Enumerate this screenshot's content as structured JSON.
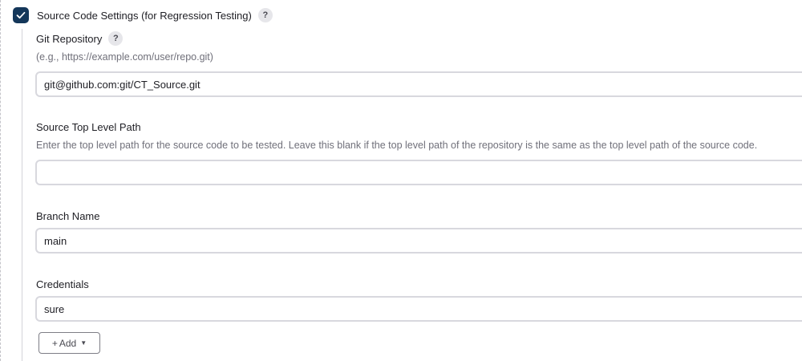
{
  "section": {
    "title": "Source Code Settings (for Regression Testing)",
    "checked": true,
    "help_label": "?"
  },
  "git_repository": {
    "label": "Git Repository",
    "help_label": "?",
    "description": "(e.g., https://example.com/user/repo.git)",
    "value": "git@github.com:git/CT_Source.git"
  },
  "source_top_level_path": {
    "label": "Source Top Level Path",
    "description": "Enter the top level path for the source code to be tested. Leave this blank if the top level path of the repository is the same as the top level path of the source code.",
    "value": ""
  },
  "branch_name": {
    "label": "Branch Name",
    "value": "main"
  },
  "credentials": {
    "label": "Credentials",
    "value": "sure"
  },
  "add_button": {
    "plus": "+",
    "label": "Add"
  },
  "colors": {
    "checkbox_fill": "#14375a",
    "input_border": "#d8d8de",
    "description_text": "#70707a"
  }
}
